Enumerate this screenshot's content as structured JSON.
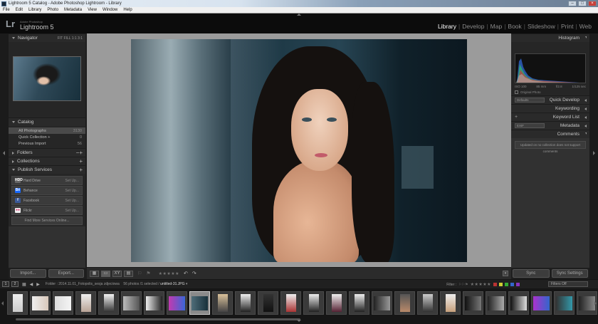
{
  "window": {
    "title": "Lightroom 5 Catalog - Adobe Photoshop Lightroom - Library"
  },
  "menu": [
    "File",
    "Edit",
    "Library",
    "Photo",
    "Metadata",
    "View",
    "Window",
    "Help"
  ],
  "identity": {
    "logo": "Lr",
    "sub": "Adobe Photoshop",
    "name": "Lightroom 5"
  },
  "modules": [
    "Library",
    "Develop",
    "Map",
    "Book",
    "Slideshow",
    "Print",
    "Web"
  ],
  "left": {
    "navigator": {
      "title": "Navigator",
      "zoom": "FIT   FILL   1:1   3:1"
    },
    "catalog": {
      "title": "Catalog",
      "items": [
        {
          "label": "All Photographs",
          "count": "3130"
        },
        {
          "label": "Quick Collection +",
          "count": "0"
        },
        {
          "label": "Previous Import",
          "count": "56"
        }
      ]
    },
    "folders": "Folders",
    "collections": "Collections",
    "publish": {
      "title": "Publish Services",
      "services": [
        {
          "icon": "HDD",
          "label": "Hard Drive",
          "setup": "Set Up..."
        },
        {
          "icon": "Bē",
          "label": "Behance",
          "setup": "Set Up..."
        },
        {
          "icon": "f",
          "label": "Facebook",
          "setup": "Set Up..."
        },
        {
          "icon": "●●",
          "label": "Flickr",
          "setup": "Set Up..."
        }
      ],
      "find_more": "Find More Services Online..."
    },
    "import": "Import...",
    "export": "Export..."
  },
  "toolbar": {
    "stars": "★★★★★"
  },
  "right": {
    "histogram": {
      "title": "Histogram",
      "info": [
        "ISO 100",
        "85 mm",
        "f/2.8",
        "1/125 sec"
      ],
      "original": "Original Photo"
    },
    "quick_develop": {
      "preset": "Defaults",
      "title": "Quick Develop"
    },
    "keywording": "Keywording",
    "keyword_list": "Keyword List",
    "metadata": {
      "preset": "EXIF",
      "title": "Metadata"
    },
    "comments": {
      "title": "Comments",
      "note": "Updated on no collection does not support comments"
    },
    "sync": "Sync",
    "sync_settings": "Sync Settings"
  },
  "filmbar": {
    "page1": "1",
    "page2": "2",
    "folder": "Folder : 2014.11.01_Fotopolis_sesja zdjeciowa",
    "count": "56 photos /1 selected /",
    "file": "untitled-31.JPG",
    "filter_label": "Filter :",
    "filter_value": "Filters Off"
  },
  "colors": {
    "accent_active": "#ffffff",
    "panel_bg": "#313131",
    "center_bg": "#9b9b9b"
  }
}
